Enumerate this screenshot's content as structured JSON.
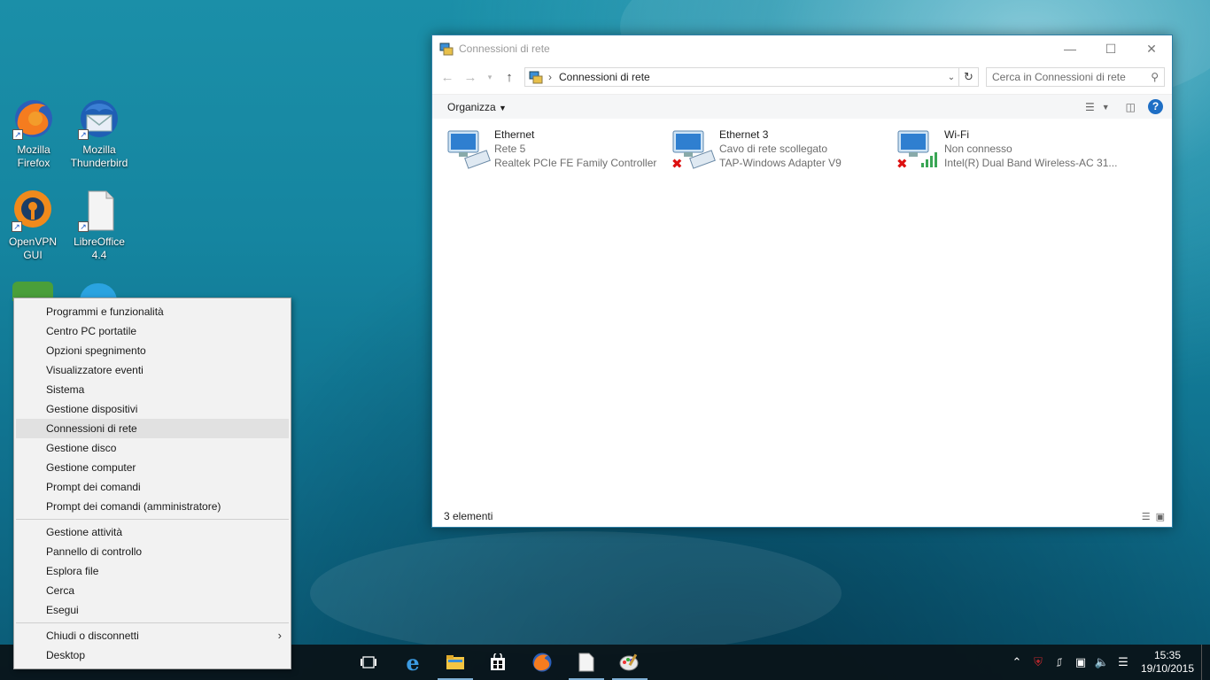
{
  "desktop": {
    "icons": [
      {
        "label_line1": "Mozilla",
        "label_line2": "Firefox"
      },
      {
        "label_line1": "Mozilla",
        "label_line2": "Thunderbird"
      },
      {
        "label_line1": "OpenVPN",
        "label_line2": "GUI"
      },
      {
        "label_line1": "LibreOffice",
        "label_line2": "4.4"
      }
    ]
  },
  "explorer": {
    "title": "Connessioni di rete",
    "address_path": "Connessioni di rete",
    "search_placeholder": "Cerca in Connessioni di rete",
    "organize_label": "Organizza",
    "connections": [
      {
        "name": "Ethernet",
        "status": "Rete  5",
        "adapter": "Realtek PCIe FE Family Controller",
        "disconnected": false
      },
      {
        "name": "Ethernet 3",
        "status": "Cavo di rete scollegato",
        "adapter": "TAP-Windows Adapter V9",
        "disconnected": true
      },
      {
        "name": "Wi-Fi",
        "status": "Non connesso",
        "adapter": "Intel(R) Dual Band Wireless-AC 31...",
        "disconnected": true
      }
    ],
    "status_count": "3 elementi"
  },
  "context_menu": {
    "group1": [
      "Programmi e funzionalità",
      "Centro PC portatile",
      "Opzioni spegnimento",
      "Visualizzatore eventi",
      "Sistema",
      "Gestione dispositivi",
      "Connessioni di rete",
      "Gestione disco",
      "Gestione computer",
      "Prompt dei comandi",
      "Prompt dei comandi (amministratore)"
    ],
    "group2": [
      "Gestione attività",
      "Pannello di controllo",
      "Esplora file",
      "Cerca",
      "Esegui"
    ],
    "group3": [
      "Chiudi o disconnetti",
      "Desktop"
    ],
    "selected": "Connessioni di rete"
  },
  "taskbar": {
    "apps": [
      "task-view-icon",
      "edge-icon",
      "file-explorer-icon",
      "store-icon",
      "firefox-icon",
      "libreoffice-icon",
      "paint-icon"
    ],
    "clock_time": "15:35",
    "clock_date": "19/10/2015"
  },
  "colors": {
    "accent": "#1f6fc5",
    "window_border": "#2d7fa6",
    "menu_bg": "#f2f2f2"
  }
}
